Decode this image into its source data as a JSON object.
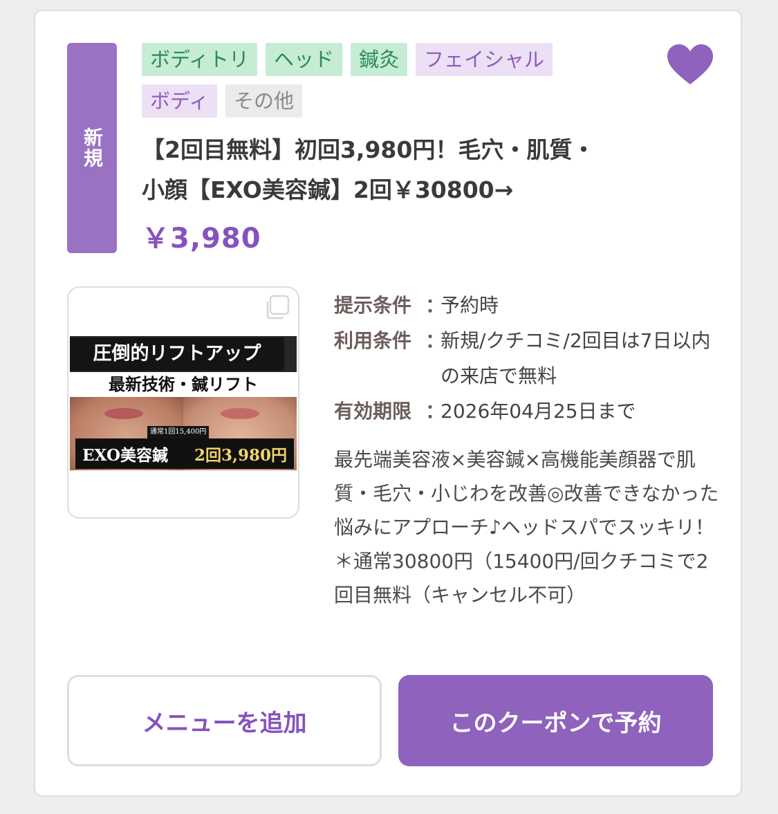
{
  "coupon": {
    "new_badge": "新規",
    "tags": [
      {
        "label": "ボディトリ",
        "style": "green"
      },
      {
        "label": "ヘッド",
        "style": "green"
      },
      {
        "label": "鍼灸",
        "style": "green"
      },
      {
        "label": "フェイシャル",
        "style": "purple"
      },
      {
        "label": "ボディ",
        "style": "purple"
      },
      {
        "label": "その他",
        "style": "gray"
      }
    ],
    "favorite_icon": "heart-icon",
    "title_line1": "【2回目無料】初回3,980円！毛穴・肌質・",
    "title_line2": "小顔【EXO美容鍼】2回￥30800→",
    "price": "￥3,980",
    "image": {
      "line1": "圧倒的リフトアップ",
      "line2": "最新技術・鍼リフト",
      "small_note": "通常1回15,400円",
      "product": "EXO美容鍼",
      "offer": "2回3,980円",
      "gallery_icon": "gallery-icon"
    },
    "conditions": [
      {
        "label": "提示条件",
        "colon": "：",
        "value": "予約時"
      },
      {
        "label": "利用条件",
        "colon": "：",
        "value": "新規/クチコミ/2回目は7日以内の来店で無料"
      },
      {
        "label": "有効期限",
        "colon": "：",
        "value": "2026年04月25日まで"
      }
    ],
    "description": "最先端美容液×美容鍼×高機能美顔器で肌質・毛穴・小じわを改善◎改善できなかった悩みにアプローチ♪ヘッドスパでスッキリ！＊通常30800円（15400円/回クチコミで2回目無料（キャンセル不可）",
    "buttons": {
      "add_menu": "メニューを追加",
      "reserve": "このクーポンで予約"
    }
  },
  "colors": {
    "accent": "#8e62bd",
    "price": "#8652bd",
    "tag_green_bg": "#c6ecd6",
    "tag_purple_bg": "#ece0f5"
  }
}
